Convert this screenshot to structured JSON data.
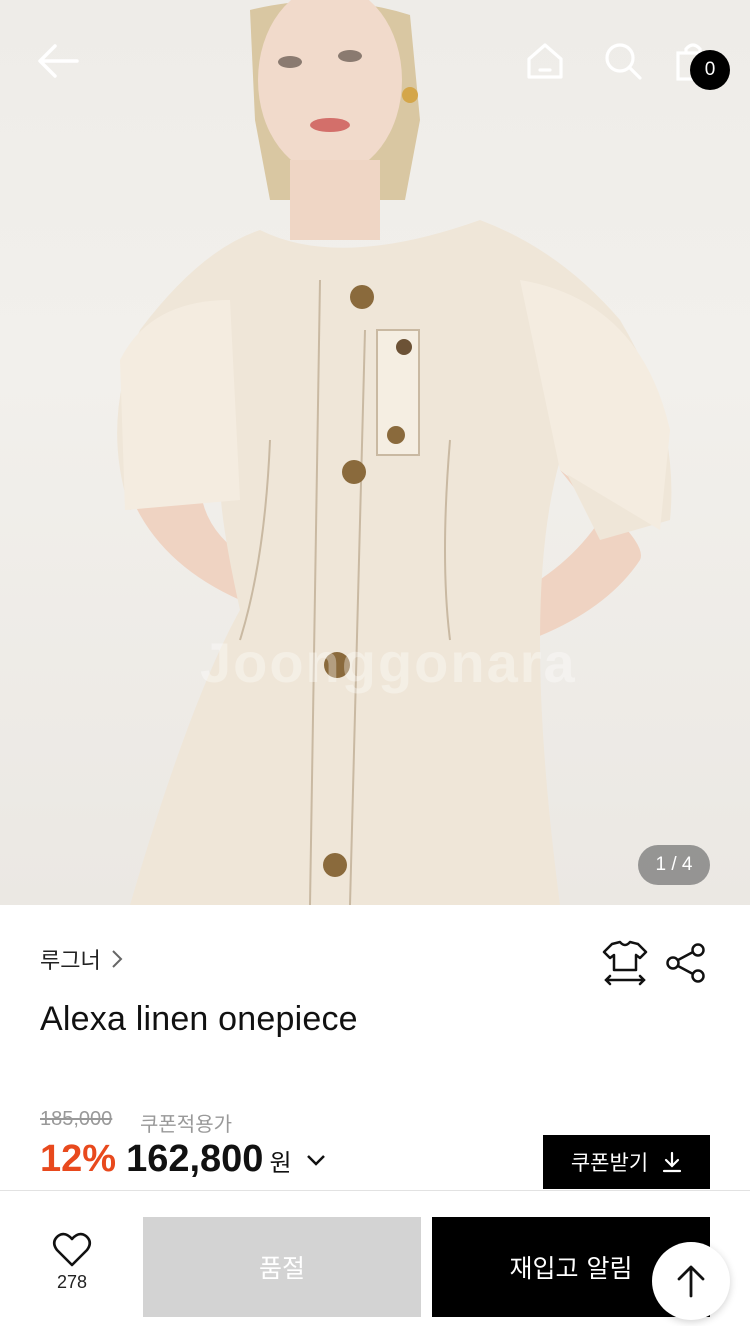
{
  "header": {
    "back_icon": "arrow-left-icon",
    "home_icon": "home-icon",
    "search_icon": "search-icon",
    "cart_icon": "shopping-bag-icon",
    "cart_count": "0"
  },
  "gallery": {
    "watermark": "Joonggonara",
    "page_indicator": "1 / 4"
  },
  "product": {
    "brand": "루그너",
    "title": "Alexa linen onepiece",
    "original_price": "185,000",
    "coupon_note": "쿠폰적용가",
    "discount": "12%",
    "price": "162,800",
    "currency": "원",
    "size_icon": "size-guide-icon",
    "share_icon": "share-icon"
  },
  "actions": {
    "coupon_label": "쿠폰받기",
    "like_count": "278",
    "soldout_label": "품절",
    "restock_label": "재입고 알림"
  },
  "colors": {
    "discount": "#e8491d",
    "soldout_bg": "#d3d3d3",
    "primary": "#000000"
  }
}
